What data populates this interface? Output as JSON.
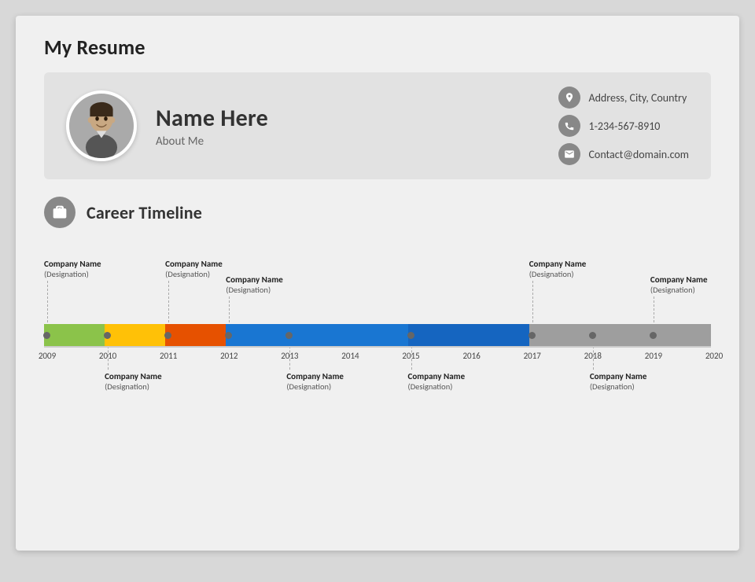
{
  "slide": {
    "title": "My Resume"
  },
  "header": {
    "name": "Name Here",
    "about": "About Me",
    "contacts": [
      {
        "icon": "📍",
        "text": "Address, City, Country",
        "type": "address"
      },
      {
        "icon": "📞",
        "text": "1-234-567-8910",
        "type": "phone"
      },
      {
        "icon": "✉",
        "text": "Contact@domain.com",
        "type": "email"
      }
    ]
  },
  "career": {
    "section_title": "Career Timeline",
    "entries_top": [
      {
        "company": "Company Name",
        "designation": "(Designation)",
        "year": 2009,
        "position": 0
      },
      {
        "company": "Company Name",
        "designation": "(Designation)",
        "year": 2011,
        "position": 2
      },
      {
        "company": "Company Name",
        "designation": "(Designation)",
        "year": 2012,
        "position": 3
      },
      {
        "company": "Company Name",
        "designation": "(Designation)",
        "year": 2017,
        "position": 8
      },
      {
        "company": "Company Name",
        "designation": "(Designation)",
        "year": 2019,
        "position": 10
      }
    ],
    "entries_bottom": [
      {
        "company": "Company Name",
        "designation": "(Designation)",
        "year": 2010,
        "position": 1
      },
      {
        "company": "Company Name",
        "designation": "(Designation)",
        "year": 2013,
        "position": 4
      },
      {
        "company": "Company Name",
        "designation": "(Designation)",
        "year": 2015,
        "position": 6
      },
      {
        "company": "Company Name",
        "designation": "(Designation)",
        "year": 2018,
        "position": 9
      }
    ],
    "bars": [
      {
        "color": "#8bc34a",
        "start": 0,
        "end": 1
      },
      {
        "color": "#ffc107",
        "start": 1,
        "end": 2
      },
      {
        "color": "#e65100",
        "start": 2,
        "end": 4
      },
      {
        "color": "#1976d2",
        "start": 3,
        "end": 6
      },
      {
        "color": "#1565c0",
        "start": 6,
        "end": 8
      },
      {
        "color": "#9e9e9e",
        "start": 8,
        "end": 11
      }
    ],
    "years": [
      "2009",
      "2010",
      "2011",
      "2012",
      "2013",
      "2014",
      "2015",
      "2016",
      "2017",
      "2018",
      "2019",
      "2020"
    ]
  }
}
